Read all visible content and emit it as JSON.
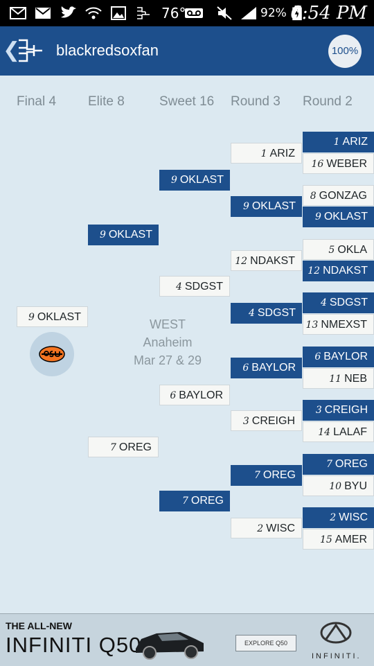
{
  "status_bar": {
    "temperature": "76°",
    "battery": "92%",
    "time": "6:54 PM",
    "icons": [
      "mail-icon",
      "gmail-icon",
      "twitter-icon",
      "wifi-icon",
      "gallery-icon",
      "bracket-notification-icon",
      "voicemail-icon",
      "mute-icon",
      "signal-icon",
      "battery-charging-icon"
    ]
  },
  "app_bar": {
    "title": "blackredsoxfan",
    "zoom": "100%",
    "background": "#1d4f8c"
  },
  "round_headers": [
    "Final 4",
    "Elite 8",
    "Sweet 16",
    "Round 3",
    "Round 2"
  ],
  "region": {
    "name": "WEST",
    "city": "Anaheim",
    "dates": "Mar 27 & 29"
  },
  "final4": [
    {
      "seed": "9",
      "team": "OKLAST"
    }
  ],
  "elite8": [
    {
      "seed": "9",
      "team": "OKLAST"
    },
    {
      "seed": "7",
      "team": "OREG"
    }
  ],
  "sweet16": [
    {
      "seed": "9",
      "team": "OKLAST"
    },
    {
      "seed": "4",
      "team": "SDGST"
    },
    {
      "seed": "6",
      "team": "BAYLOR"
    },
    {
      "seed": "7",
      "team": "OREG"
    }
  ],
  "round3": [
    {
      "seed": "1",
      "team": "ARIZ"
    },
    {
      "seed": "9",
      "team": "OKLAST"
    },
    {
      "seed": "12",
      "team": "NDAKST"
    },
    {
      "seed": "4",
      "team": "SDGST"
    },
    {
      "seed": "6",
      "team": "BAYLOR"
    },
    {
      "seed": "3",
      "team": "CREIGH"
    },
    {
      "seed": "7",
      "team": "OREG"
    },
    {
      "seed": "2",
      "team": "WISC"
    }
  ],
  "round2": [
    {
      "seed": "1",
      "team": "ARIZ"
    },
    {
      "seed": "16",
      "team": "WEBER"
    },
    {
      "seed": "8",
      "team": "GONZAG"
    },
    {
      "seed": "9",
      "team": "OKLAST"
    },
    {
      "seed": "5",
      "team": "OKLA"
    },
    {
      "seed": "12",
      "team": "NDAKST"
    },
    {
      "seed": "4",
      "team": "SDGST"
    },
    {
      "seed": "13",
      "team": "NMEXST"
    },
    {
      "seed": "6",
      "team": "BAYLOR"
    },
    {
      "seed": "11",
      "team": "NEB"
    },
    {
      "seed": "3",
      "team": "CREIGH"
    },
    {
      "seed": "14",
      "team": "LALAF"
    },
    {
      "seed": "7",
      "team": "OREG"
    },
    {
      "seed": "10",
      "team": "BYU"
    },
    {
      "seed": "2",
      "team": "WISC"
    },
    {
      "seed": "15",
      "team": "AMER"
    }
  ],
  "champion_logo": "osu",
  "ad": {
    "line1": "THE ALL-NEW",
    "line2": "INFINITI Q50",
    "cta": "EXPLORE Q50",
    "brand": "INFINITI."
  },
  "colors": {
    "winner": "#1d4f8c",
    "loser": "#f6f7f5",
    "background": "#dce9f1"
  }
}
